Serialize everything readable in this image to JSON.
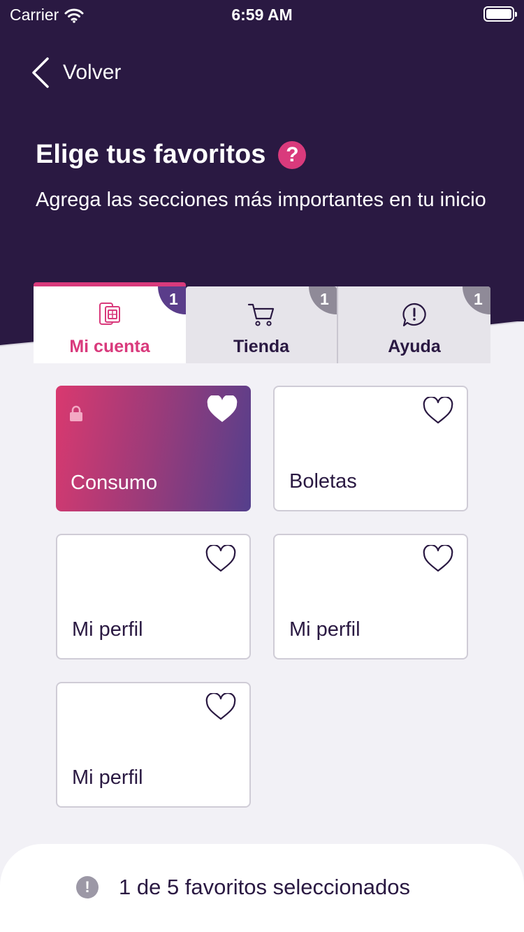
{
  "status_bar": {
    "carrier": "Carrier",
    "time": "6:59 AM"
  },
  "nav": {
    "back_label": "Volver"
  },
  "header": {
    "title": "Elige tus favoritos",
    "help_symbol": "?",
    "subtitle": "Agrega las secciones más importantes en tu inicio"
  },
  "tabs": [
    {
      "label": "Mi cuenta",
      "badge": "1",
      "icon": "sim-card-icon",
      "active": true
    },
    {
      "label": "Tienda",
      "badge": "1",
      "icon": "cart-icon",
      "active": false
    },
    {
      "label": "Ayuda",
      "badge": "1",
      "icon": "chat-alert-icon",
      "active": false
    }
  ],
  "cards": [
    {
      "label": "Consumo",
      "favorite": true,
      "locked": true
    },
    {
      "label": "Boletas",
      "favorite": false,
      "locked": false
    },
    {
      "label": "Mi perfil",
      "favorite": false,
      "locked": false
    },
    {
      "label": "Mi perfil",
      "favorite": false,
      "locked": false
    },
    {
      "label": "Mi perfil",
      "favorite": false,
      "locked": false
    }
  ],
  "footer": {
    "info_symbol": "!",
    "summary": "1 de 5 favoritos seleccionados"
  },
  "colors": {
    "header_bg": "#2a1942",
    "accent": "#d93a7c",
    "gradient_end": "#543f8c",
    "page_bg": "#f2f1f6"
  }
}
